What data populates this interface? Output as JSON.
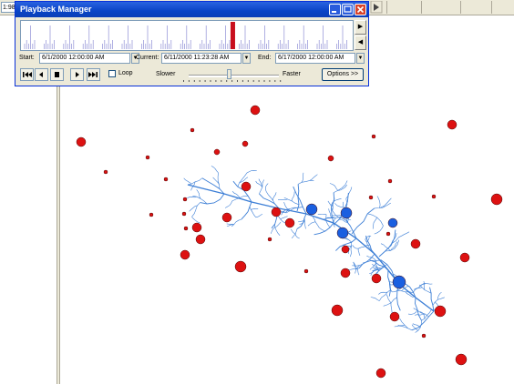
{
  "toolbar": {
    "scale_value": "1:98"
  },
  "window": {
    "title": "Playback Manager"
  },
  "controls": {
    "start_label": "Start:",
    "start_value": "6/1/2000 12:00:00 AM",
    "current_label": "Current:",
    "current_value": "6/11/2000 11:23:28 AM",
    "end_label": "End:",
    "end_value": "6/17/2000 12:00:00 AM",
    "loop_label": "Loop",
    "slower_label": "Slower",
    "faster_label": "Faster",
    "options_label": "Options >>",
    "loop_checked": false
  },
  "timeline": {
    "current_fraction": 0.64
  },
  "colors": {
    "river": "#3d7fd6",
    "red_station": "#dd1111",
    "blue_station": "#1a5fe0",
    "titlebar": "#0a44c6"
  },
  "icons": {
    "first": "skip-to-start-icon",
    "prev": "step-back-icon",
    "stop": "stop-icon",
    "play": "play-icon",
    "last": "skip-to-end-icon"
  }
}
